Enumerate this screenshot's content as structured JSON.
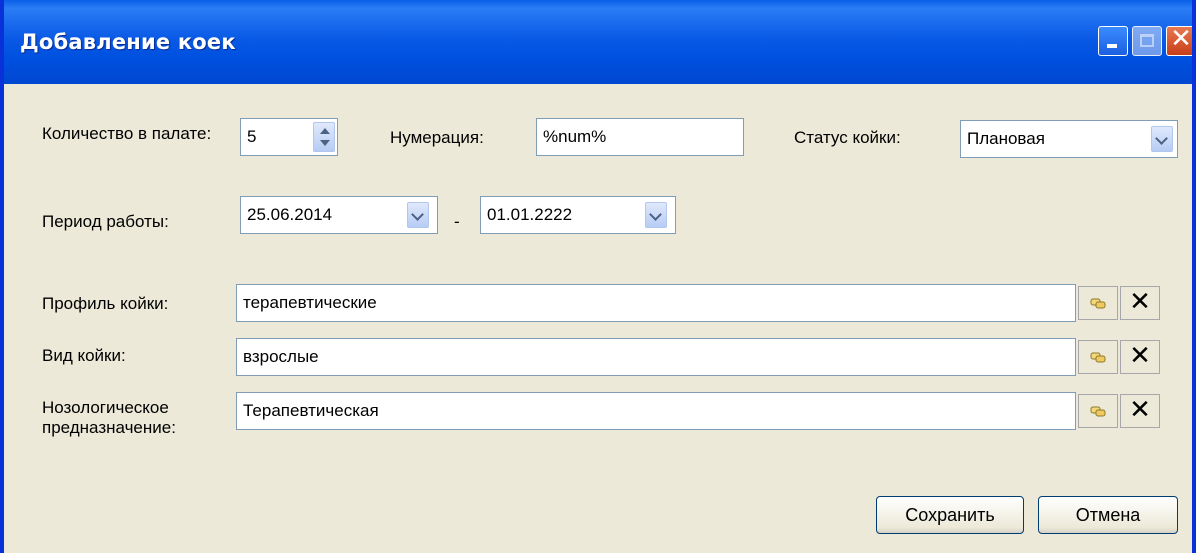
{
  "window": {
    "title": "Добавление коек"
  },
  "form": {
    "count_label": "Количество в палате:",
    "count_value": "5",
    "numbering_label": "Нумерация:",
    "numbering_value": "%num%",
    "status_label": "Статус койки:",
    "status_value": "Плановая",
    "period_label": "Период работы:",
    "period_from": "25.06.2014",
    "period_separator": "-",
    "period_to": "01.01.2222",
    "profile_label": "Профиль койки:",
    "profile_value": "терапевтические",
    "kind_label": "Вид койки:",
    "kind_value": "взрослые",
    "nosology_label": "Нозологическое предназначение:",
    "nosology_value": "Терапевтическая"
  },
  "buttons": {
    "save": "Сохранить",
    "cancel": "Отмена",
    "clear_glyph": "✕"
  },
  "icons": {
    "picker": "chain-link-icon",
    "clear": "close-icon"
  }
}
